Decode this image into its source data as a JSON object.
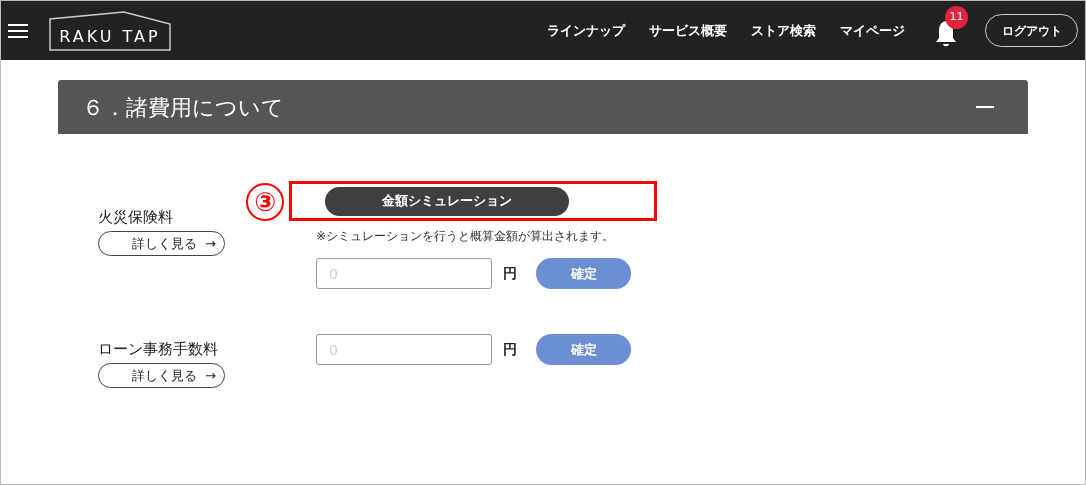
{
  "header": {
    "logo": "RAKU TAP",
    "nav": [
      "ラインナップ",
      "サービス概要",
      "ストア検索",
      "マイページ"
    ],
    "notification_count": "11",
    "logout": "ログアウト"
  },
  "section": {
    "title": "６．諸費用について",
    "expanded": true
  },
  "fees": [
    {
      "label": "火災保険料",
      "more": "詳しく見る",
      "arrow": "→",
      "simulation": {
        "button": "金額シミュレーション",
        "annotation": "③",
        "note": "※シミュレーションを行うと概算金額が算出されます。"
      },
      "placeholder": "0",
      "unit": "円",
      "confirm": "確定"
    },
    {
      "label": "ローン事務手数料",
      "more": "詳しく見る",
      "arrow": "→",
      "placeholder": "0",
      "unit": "円",
      "confirm": "確定"
    }
  ]
}
